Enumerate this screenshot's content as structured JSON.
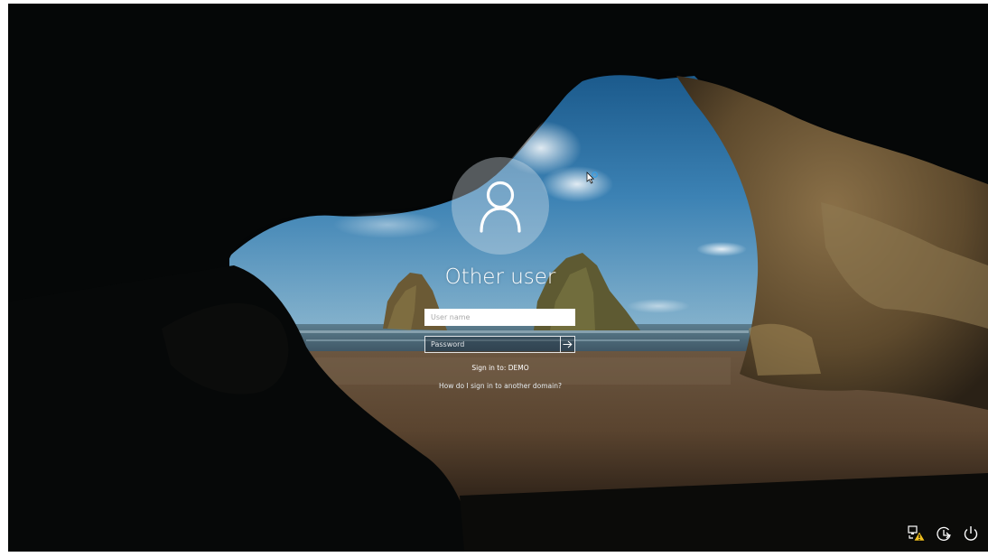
{
  "login": {
    "user_title": "Other user",
    "username_placeholder": "User name",
    "password_placeholder": "Password",
    "sign_in_to": "Sign in to: DEMO",
    "other_domain_link": "How do I sign in to another domain?"
  },
  "tray": {
    "icons": [
      "network-warning-icon",
      "ease-of-access-icon",
      "power-icon"
    ]
  },
  "colors": {
    "avatar_bg": "#d7e1eb",
    "text": "#ffffff",
    "cursor_ring": "#3a9de0"
  }
}
